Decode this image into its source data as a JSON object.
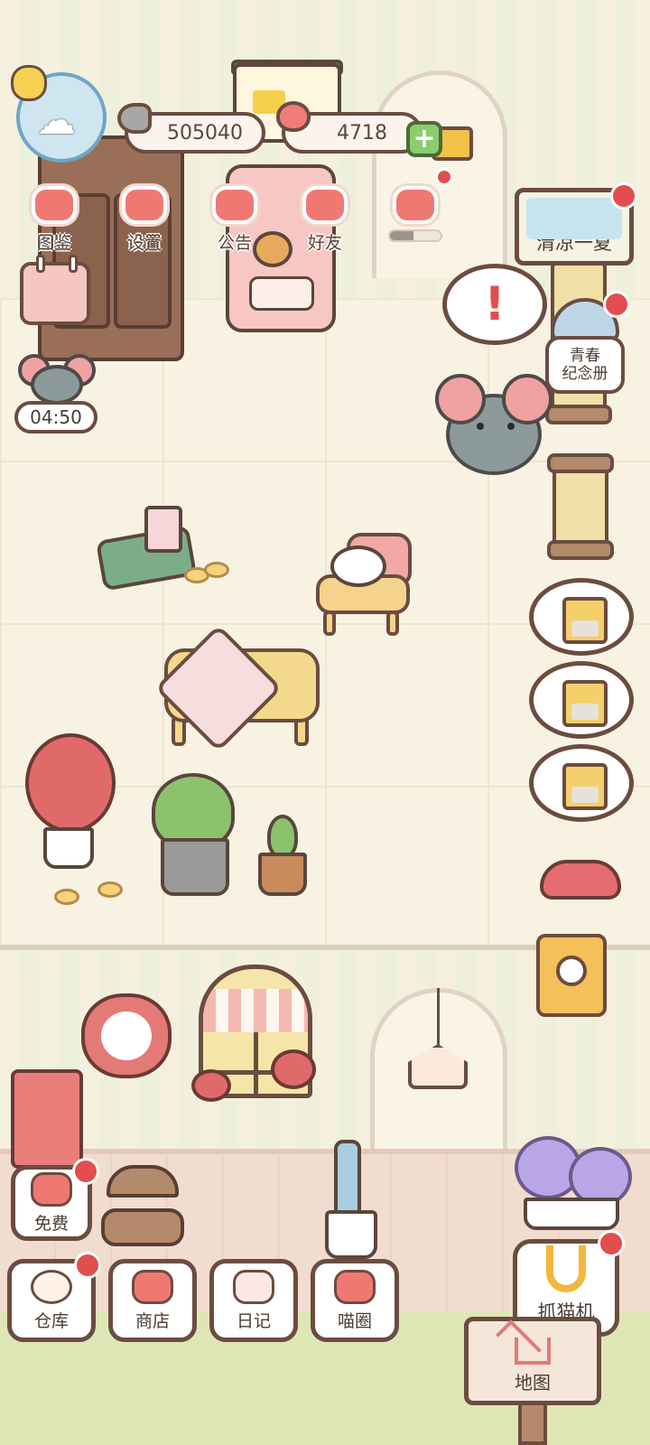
{
  "hud": {
    "fish_currency": "505040",
    "heart_currency": "4718",
    "plus_symbol": "+"
  },
  "top_menu": [
    {
      "label": "图鉴",
      "icon": "cat-book-icon"
    },
    {
      "label": "设置",
      "icon": "gear-icon"
    },
    {
      "label": "公告",
      "icon": "gift-icon"
    },
    {
      "label": "好友",
      "icon": "friends-icon"
    },
    {
      "label": "",
      "icon": "hearts-icon"
    }
  ],
  "hearts_progress": 0.46,
  "timer": "04:50",
  "event": {
    "summer_label": "清凉一夏",
    "youth_label_line1": "青春",
    "youth_label_line2": "纪念册"
  },
  "alert": "!",
  "bottom_left": {
    "free_label": "免费"
  },
  "bottom_menu": [
    {
      "label": "仓库",
      "icon": "storage-icon"
    },
    {
      "label": "商店",
      "icon": "shop-icon"
    },
    {
      "label": "日记",
      "icon": "diary-icon"
    },
    {
      "label": "喵圈",
      "icon": "cat-planet-icon"
    }
  ],
  "claw_machine_label": "抓猫机",
  "map_label": "地图",
  "colors": {
    "accent_red": "#e24d4d",
    "outline_brown": "#6b4c40",
    "floor_cream": "#f8f2e2"
  }
}
